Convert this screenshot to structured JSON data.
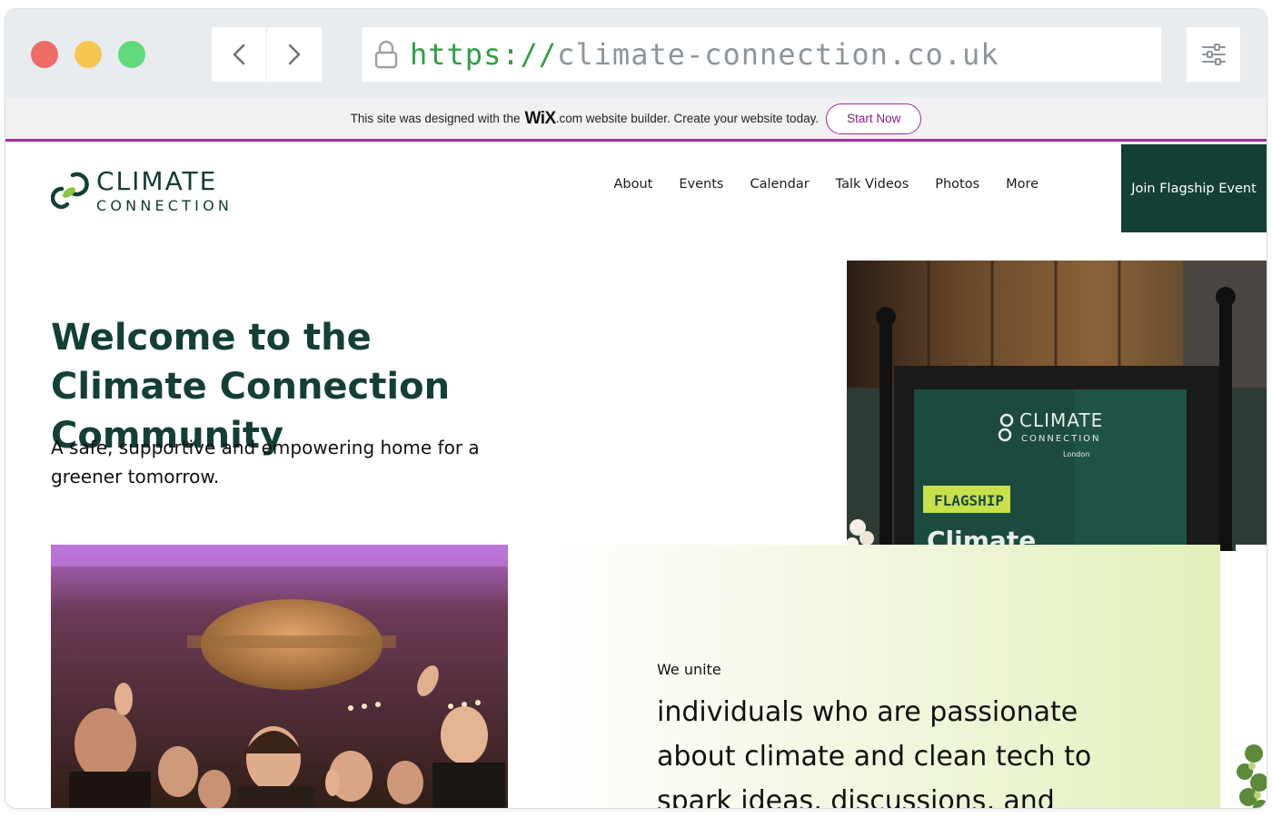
{
  "browser": {
    "url_scheme": "https://",
    "url_host": "climate-connection.co.uk"
  },
  "wix_banner": {
    "text_before": "This site was designed with the",
    "brand": "WiX",
    "text_after": ".com website builder. Create your website today.",
    "cta": "Start Now",
    "accent_color": "#a12ba0"
  },
  "site": {
    "logo": {
      "title": "CLIMATE",
      "subtitle": "CONNECTION"
    },
    "nav": [
      {
        "label": "About"
      },
      {
        "label": "Events"
      },
      {
        "label": "Calendar"
      },
      {
        "label": "Talk Videos"
      },
      {
        "label": "Photos"
      },
      {
        "label": "More"
      }
    ],
    "cta": "Join Flagship Event",
    "brand_color": "#133f37"
  },
  "hero": {
    "title": "Welcome to the Climate Connection Community",
    "subtitle": "A safe, supportive and empowering home for a greener tomorrow."
  },
  "sign_photo": {
    "sign_title": "CLIMATE",
    "sign_subtitle": "CONNECTION",
    "sign_city": "London",
    "badge": "FLAGSHIP",
    "partial_word": "Climate"
  },
  "unite": {
    "label": "We unite",
    "text": "individuals who are passionate about climate and clean tech to spark ideas, discussions, and"
  }
}
